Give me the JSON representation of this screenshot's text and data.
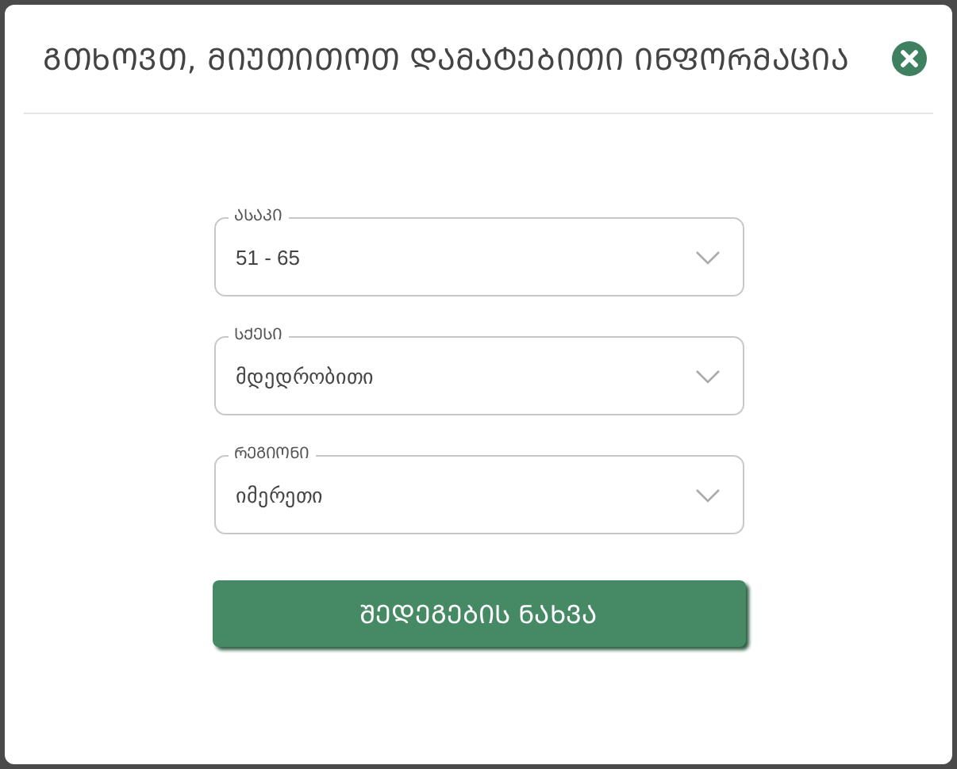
{
  "dialog": {
    "title": "ᲒᲗᲮᲝᲕᲗ, ᲛᲘᲣᲗᲘᲗᲝᲗ ᲓᲐᲛᲐᲢᲔᲑᲘᲗᲘ ᲘᲜᲤᲝᲠᲛᲐᲪᲘᲐ"
  },
  "fields": [
    {
      "label": "ᲐᲡᲐᲙᲘ",
      "value": "51 - 65"
    },
    {
      "label": "ᲡᲥᲔᲡᲘ",
      "value": "მდედრობითი"
    },
    {
      "label": "ᲠᲔᲒᲘᲝᲜᲘ",
      "value": "იმერეთი"
    }
  ],
  "submit_button": "ᲨᲔᲓᲔᲒᲔᲑᲘᲡ ᲜᲐᲮᲕᲐ"
}
